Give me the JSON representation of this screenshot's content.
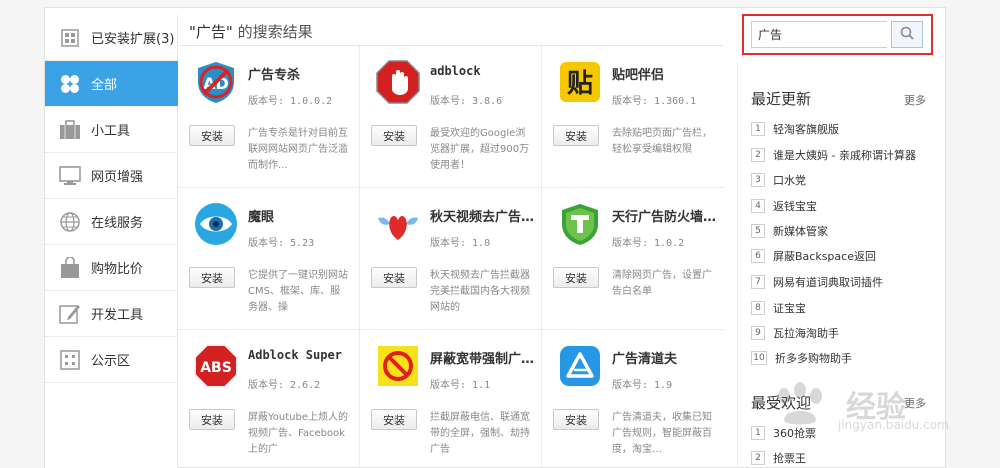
{
  "sidebar": {
    "items": [
      {
        "label": "已安装扩展(3)",
        "icon": "grid-box-icon"
      },
      {
        "label": "全部",
        "icon": "clover-icon"
      },
      {
        "label": "小工具",
        "icon": "briefcase-icon"
      },
      {
        "label": "网页增强",
        "icon": "monitor-icon"
      },
      {
        "label": "在线服务",
        "icon": "globe-icon"
      },
      {
        "label": "购物比价",
        "icon": "shopping-bag-icon"
      },
      {
        "label": "开发工具",
        "icon": "edit-icon"
      },
      {
        "label": "公示区",
        "icon": "grid-dots-icon"
      }
    ],
    "active_index": 1,
    "accent": "#3ba2e6"
  },
  "results": {
    "title_prefix": "\"广告\"",
    "title_suffix": " 的搜索结果"
  },
  "install_label": "安装",
  "cards": [
    {
      "name": "广告专杀",
      "version": "版本号: 1.0.0.2",
      "desc": "广告专杀是针对目前互联网网站网页广告泛滥而制作...",
      "icon": "ad-killer-icon"
    },
    {
      "name": "adblock",
      "version": "版本号: 3.8.6",
      "desc": "最受欢迎的Google浏览器扩展，超过900万使用者！",
      "icon": "stop-hand-icon"
    },
    {
      "name": "贴吧伴侣",
      "version": "版本号: 1.360.1",
      "desc": "去除贴吧页面广告栏，轻松享受编辑权限",
      "icon": "tie-badge-icon"
    },
    {
      "name": "魔眼",
      "version": "版本号: 5.23",
      "desc": "它提供了一键识别网站CMS、框架、库、服务器、操",
      "icon": "eye-icon"
    },
    {
      "name": "秋天视频去广告…",
      "version": "版本号: 1.0",
      "desc": "秋天视频去广告拦截器完美拦截国内各大视频网站的",
      "icon": "winged-heart-icon"
    },
    {
      "name": "天行广告防火墙…",
      "version": "版本号: 1.0.2",
      "desc": "清除网页广告，设置广告白名单",
      "icon": "shield-t-icon"
    },
    {
      "name": "Adblock Super",
      "version": "版本号: 2.6.2",
      "desc": "屏蔽Youtube上烦人的视频广告、Facebook上的广",
      "icon": "abs-octagon-icon"
    },
    {
      "name": "屏蔽宽带强制广…",
      "version": "版本号: 1.1",
      "desc": "拦截屏蔽电信、联通宽带的全屏，强制、劫持广告",
      "icon": "no-sign-icon"
    },
    {
      "name": "广告清道夫",
      "version": "版本号: 1.9",
      "desc": "广告清道夫，收集已知广告规则，智能屏蔽百度，淘宝…",
      "icon": "triangle-logo-icon"
    }
  ],
  "search": {
    "value": "广告",
    "icon": "search-icon"
  },
  "recent": {
    "heading": "最近更新",
    "more": "更多",
    "items": [
      {
        "num": "1",
        "label": "轻淘客旗舰版"
      },
      {
        "num": "2",
        "label": "谁是大姨妈 - 亲戚称谓计算器"
      },
      {
        "num": "3",
        "label": "口水党"
      },
      {
        "num": "4",
        "label": "返钱宝宝"
      },
      {
        "num": "5",
        "label": "新媒体管家"
      },
      {
        "num": "6",
        "label": "屏蔽Backspace返回"
      },
      {
        "num": "7",
        "label": "网易有道词典取词插件"
      },
      {
        "num": "8",
        "label": "证宝宝"
      },
      {
        "num": "9",
        "label": "瓦拉海淘助手"
      },
      {
        "num": "10",
        "label": "折多多购物助手"
      }
    ]
  },
  "popular": {
    "heading": "最受欢迎",
    "more": "更多",
    "items": [
      {
        "num": "1",
        "label": "360抢票"
      },
      {
        "num": "2",
        "label": "抢票王"
      }
    ]
  },
  "watermark": {
    "text": "经验",
    "sub": "jingyan.baidu.com"
  }
}
